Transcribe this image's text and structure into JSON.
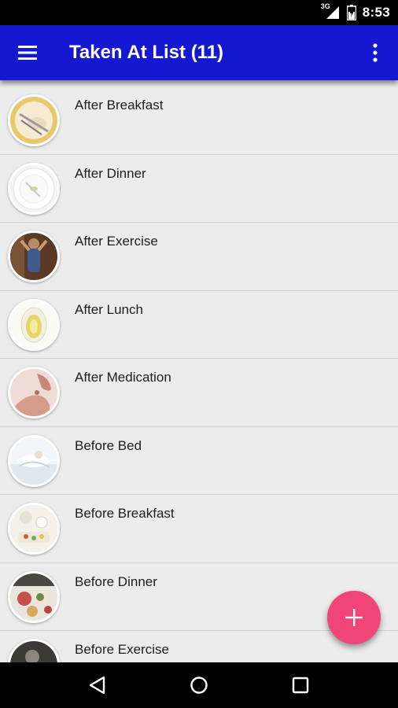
{
  "status_bar": {
    "network": "3G",
    "time": "8:53"
  },
  "app_bar": {
    "title": "Taken At List (11)",
    "menu_icon": "hamburger-menu-icon",
    "overflow_icon": "more-vert-icon",
    "color": "#1418d0"
  },
  "list": {
    "items": [
      {
        "label": "After Breakfast",
        "icon": "plate-fork-image",
        "colors": [
          "#f6ecd4",
          "#b9a98a",
          "#e2b955"
        ]
      },
      {
        "label": "After Dinner",
        "icon": "empty-plate-image",
        "colors": [
          "#fafafa",
          "#d9d4cc",
          "#c9b894"
        ]
      },
      {
        "label": "After Exercise",
        "icon": "exercise-woman-image",
        "colors": [
          "#5a3a26",
          "#3d5b8c",
          "#c79a74"
        ]
      },
      {
        "label": "After Lunch",
        "icon": "lunch-plate-image",
        "colors": [
          "#fbfbf6",
          "#e6d66a",
          "#b8aa4a"
        ]
      },
      {
        "label": "After Medication",
        "icon": "medication-hands-image",
        "colors": [
          "#efdcd6",
          "#d69c8a",
          "#b06c5c"
        ]
      },
      {
        "label": "Before Bed",
        "icon": "bed-image",
        "colors": [
          "#f2f6fa",
          "#d6e0ea",
          "#e8dcd2"
        ]
      },
      {
        "label": "Before Breakfast",
        "icon": "breakfast-table-image",
        "colors": [
          "#f4f1ea",
          "#d8cfc0",
          "#7aa658"
        ]
      },
      {
        "label": "Before Dinner",
        "icon": "dinner-table-image",
        "colors": [
          "#e9e6e0",
          "#c8504a",
          "#6e8a4a"
        ]
      },
      {
        "label": "Before Exercise",
        "icon": "pre-exercise-image",
        "colors": [
          "#3c3a36",
          "#8a8680",
          "#c7c2b8"
        ]
      }
    ]
  },
  "fab": {
    "icon": "add-icon",
    "color": "#ef4577"
  },
  "nav_bar": {
    "back_icon": "back-triangle-icon",
    "home_icon": "home-circle-icon",
    "recents_icon": "recents-square-icon"
  }
}
